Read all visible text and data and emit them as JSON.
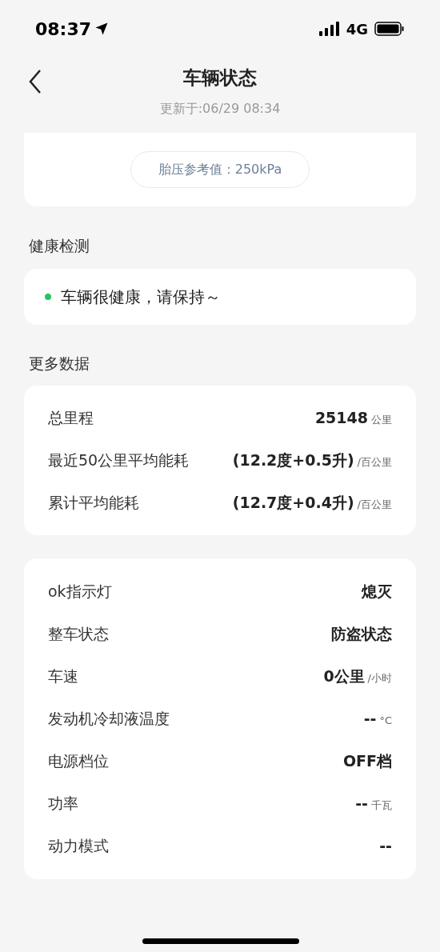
{
  "status_bar": {
    "time": "08:37",
    "network": "4G"
  },
  "header": {
    "title": "车辆状态",
    "updated": "更新于:06/29 08:34"
  },
  "tire_card": {
    "reference": "胎压参考值：250kPa"
  },
  "health": {
    "section_title": "健康检测",
    "status": "车辆很健康，请保持～",
    "color": "#22c55e"
  },
  "more_data": {
    "section_title": "更多数据",
    "rows": [
      {
        "label": "总里程",
        "value": "25148",
        "unit": "公里"
      },
      {
        "label": "最近50公里平均能耗",
        "value": "(12.2度+0.5升)",
        "unit": "/百公里"
      },
      {
        "label": "累计平均能耗",
        "value": "(12.7度+0.4升)",
        "unit": "/百公里"
      }
    ]
  },
  "vehicle_rows": [
    {
      "label": "ok指示灯",
      "value": "熄灭"
    },
    {
      "label": "整车状态",
      "value": "防盗状态"
    },
    {
      "label": "车速",
      "value": "0公里",
      "unit": "/小时"
    },
    {
      "label": "发动机冷却液温度",
      "value": "--",
      "unit": "°C"
    },
    {
      "label": "电源档位",
      "value": "OFF档"
    },
    {
      "label": "功率",
      "value": "--",
      "unit": "千瓦"
    },
    {
      "label": "动力模式",
      "value": "--"
    }
  ]
}
